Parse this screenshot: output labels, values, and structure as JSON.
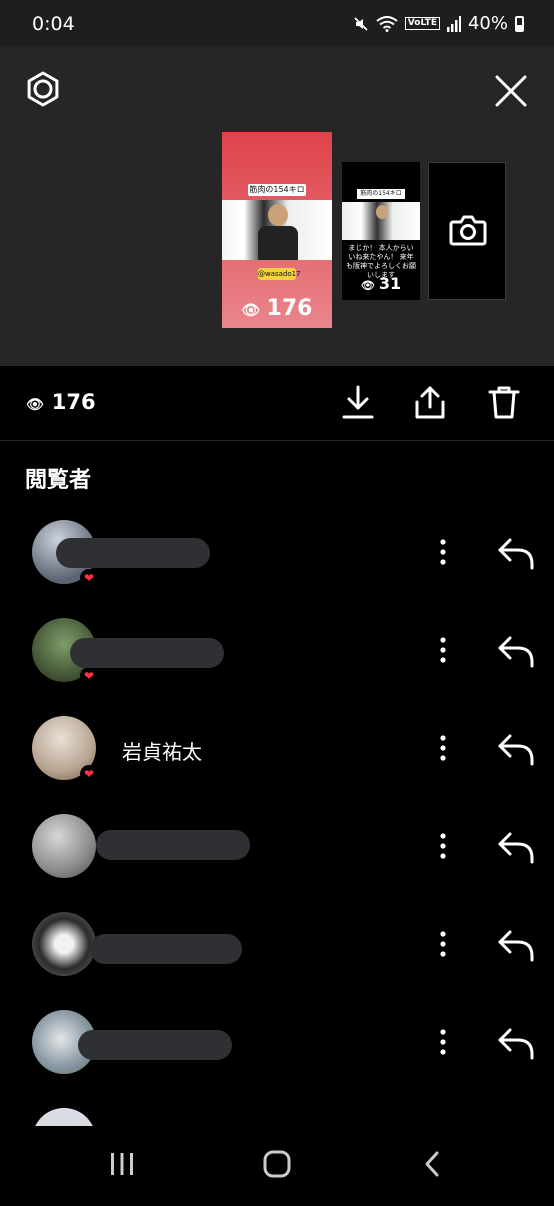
{
  "status_bar": {
    "time": "0:04",
    "volte": "VoLTE",
    "battery": "40%"
  },
  "preview": {
    "main": {
      "caption": "筋肉の154キロ",
      "handle": "@wasado17",
      "views": "176"
    },
    "second": {
      "caption": "筋肉の154キロ",
      "text": "まじか！ 本人からいいね来たやん！ 来年も阪神でよろしくお願いします",
      "views": "31"
    }
  },
  "action_bar": {
    "views": "176"
  },
  "viewers": {
    "title": "閲覧者",
    "items": [
      {
        "name": "",
        "liked": true
      },
      {
        "name": "",
        "liked": true
      },
      {
        "name": "岩貞祐太",
        "liked": true
      },
      {
        "name": "",
        "liked": false
      },
      {
        "name": "",
        "liked": false
      },
      {
        "name": "",
        "liked": false
      }
    ]
  },
  "icons": {
    "settings": "gear-icon",
    "close": "close-icon",
    "camera": "camera-icon",
    "eye": "eye-icon",
    "download": "download-icon",
    "share": "share-icon",
    "delete": "trash-icon",
    "heart": "heart-icon",
    "more": "more-vertical-icon",
    "reply": "reply-icon",
    "recents": "recents-icon",
    "home": "home-icon",
    "back": "back-icon"
  },
  "colors": {
    "like_heart": "#ff3040",
    "panel_bg": "#262626",
    "main_thumb": "#e0424a"
  }
}
